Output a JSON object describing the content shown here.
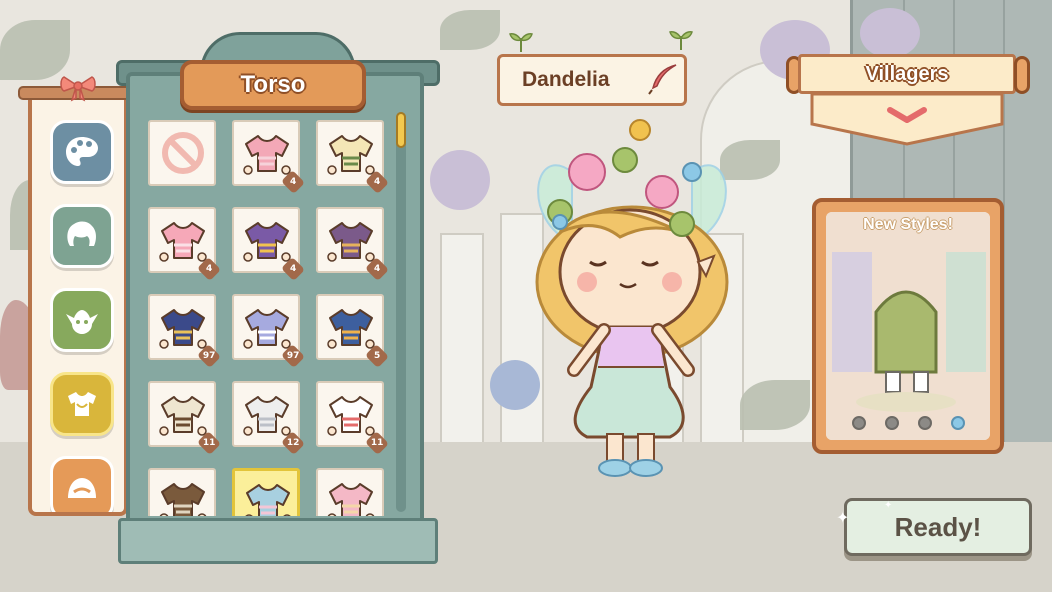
{
  "wardrobe": {
    "category_title": "Torso",
    "items": [
      {
        "icon": "no-clothing-icon",
        "badge": "",
        "colors": [
          "#f1b9b0",
          "#f1b9b0"
        ]
      },
      {
        "icon": "shirt-icon",
        "badge": "4",
        "colors": [
          "#f3a8b7",
          "#f6d2da"
        ]
      },
      {
        "icon": "shirt-icon",
        "badge": "4",
        "colors": [
          "#f4e6b6",
          "#6a8a4a"
        ]
      },
      {
        "icon": "shirt-icon",
        "badge": "4",
        "colors": [
          "#f6a8b8",
          "#fbe0e6"
        ]
      },
      {
        "icon": "shirt-icon",
        "badge": "4",
        "colors": [
          "#7a5aa6",
          "#f1c24f"
        ]
      },
      {
        "icon": "shirt-icon",
        "badge": "4",
        "colors": [
          "#7b5a8a",
          "#e6b25c"
        ]
      },
      {
        "icon": "shirt-icon",
        "badge": "97",
        "colors": [
          "#3b4a8a",
          "#e9c15a"
        ]
      },
      {
        "icon": "shirt-icon",
        "badge": "97",
        "colors": [
          "#a6aadf",
          "#ffffff"
        ]
      },
      {
        "icon": "shirt-icon",
        "badge": "5",
        "colors": [
          "#3d5f9e",
          "#f0b24c"
        ]
      },
      {
        "icon": "shirt-icon",
        "badge": "11",
        "colors": [
          "#efe6d0",
          "#6b4b2f"
        ]
      },
      {
        "icon": "shirt-icon",
        "badge": "12",
        "colors": [
          "#eeeeee",
          "#bcc0c8"
        ]
      },
      {
        "icon": "shirt-icon",
        "badge": "11",
        "colors": [
          "#ffffff",
          "#e46b6b"
        ]
      },
      {
        "icon": "shirt-icon",
        "badge": "",
        "colors": [
          "#7a5a3c",
          "#e0d5c0"
        ]
      },
      {
        "icon": "shirt-icon",
        "badge": "",
        "colors": [
          "#a8d0e0",
          "#f3c6d6"
        ],
        "selected": true
      },
      {
        "icon": "shirt-icon",
        "badge": "",
        "colors": [
          "#f4b8c6",
          "#f4d6a8"
        ]
      }
    ]
  },
  "categories": [
    {
      "name": "palette-icon",
      "color": "#6d8fa3"
    },
    {
      "name": "hair-icon",
      "color": "#7ea392"
    },
    {
      "name": "face-icon",
      "color": "#87a95d"
    },
    {
      "name": "torso-icon",
      "color": "#d9b63b",
      "selected": true
    },
    {
      "name": "accessory-icon",
      "color": "#e59a58"
    }
  ],
  "character": {
    "name": "Dandelia"
  },
  "villagers": {
    "label": "Villagers"
  },
  "styles_card": {
    "title": "New Styles!",
    "page_count": 4,
    "active_page": 4
  },
  "ready_button": {
    "label": "Ready!"
  }
}
